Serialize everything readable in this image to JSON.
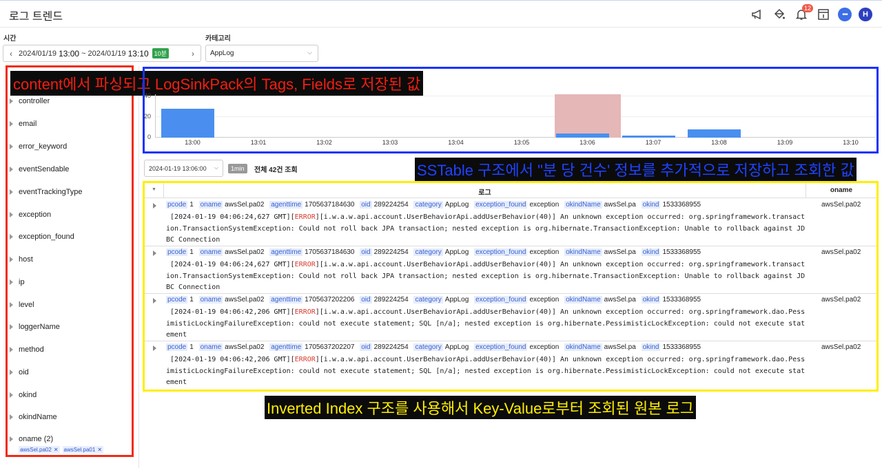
{
  "header": {
    "title": "로그 트렌드",
    "notif_count": "12",
    "avatar_letter": "H",
    "icons": [
      "megaphone-icon",
      "paint-bucket-icon",
      "bell-icon",
      "info-panel-icon",
      "chat-icon",
      "avatar"
    ]
  },
  "filters": {
    "time_label": "시간",
    "time_start_date": "2024/01/19",
    "time_start": "13:00",
    "time_sep": "~",
    "time_end_date": "2024/01/19",
    "time_end": "13:10",
    "time_span_badge": "10분",
    "category_label": "카테고리",
    "category_value": "AppLog"
  },
  "sidebar": {
    "fields": [
      "controller",
      "email",
      "error_keyword",
      "eventSendable",
      "eventTrackingType",
      "exception",
      "exception_found",
      "host",
      "ip",
      "level",
      "loggerName",
      "method",
      "oid",
      "okind",
      "okindName",
      "oname (2)"
    ],
    "selected_chips": [
      "awsSel.pa02",
      "awsSel.pa01"
    ]
  },
  "annotations": {
    "red": "content에서 파싱되고 LogSinkPack의 Tags, Fields로 저장된 값",
    "blue": "SSTable 구조에서 \"분 당 건수' 정보를 추가적으로 저장하고 조회한 값",
    "yellow": "Inverted Index 구조를 사용해서 Key-Value로부터 조회된 원본 로그"
  },
  "chart_data": {
    "type": "bar",
    "categories": [
      "13:00",
      "13:01",
      "13:02",
      "13:03",
      "13:04",
      "13:05",
      "13:06",
      "13:07",
      "13:08",
      "13:09",
      "13:10"
    ],
    "values": [
      28,
      0,
      0,
      0,
      0,
      0,
      4,
      2,
      8,
      0,
      0
    ],
    "highlight_category": "13:06",
    "yticks": [
      "40",
      "20",
      "0"
    ],
    "ylim": [
      0,
      40
    ],
    "grid": true,
    "colors": {
      "bar": "#4a8fef",
      "highlight": "#e5b7b7"
    }
  },
  "results": {
    "selected_time": "2024-01-19 13:06:00",
    "interval_badge": "1min",
    "total_text": "전체 42건 조회",
    "columns": {
      "log": "로그",
      "oname": "oname"
    },
    "rows": [
      {
        "pcode": "1",
        "oname": "awsSel.pa02",
        "agenttime": "1705637184630",
        "oid": "289224254",
        "category": "AppLog",
        "exception_found": "exception",
        "okindName": "awsSel.pa",
        "okind": "1533368955",
        "msg_prefix": " [2024-01-19 04:06:24,627 GMT][",
        "level": "ERROR",
        "msg_rest": "][i.w.a.w.api.account.UserBehaviorApi.addUserBehavior(40)] An unknown exception occurred: org.springframework.transaction.TransactionSystemException: Could not roll back JPA transaction; nested exception is org.hibernate.TransactionException: Unable to rollback against JDBC Connection",
        "oname_col": "awsSel.pa02"
      },
      {
        "pcode": "1",
        "oname": "awsSel.pa02",
        "agenttime": "1705637184630",
        "oid": "289224254",
        "category": "AppLog",
        "exception_found": "exception",
        "okindName": "awsSel.pa",
        "okind": "1533368955",
        "msg_prefix": " [2024-01-19 04:06:24,627 GMT][",
        "level": "ERROR",
        "msg_rest": "][i.w.a.w.api.account.UserBehaviorApi.addUserBehavior(40)] An unknown exception occurred: org.springframework.transaction.TransactionSystemException: Could not roll back JPA transaction; nested exception is org.hibernate.TransactionException: Unable to rollback against JDBC Connection",
        "oname_col": "awsSel.pa02"
      },
      {
        "pcode": "1",
        "oname": "awsSel.pa02",
        "agenttime": "1705637202206",
        "oid": "289224254",
        "category": "AppLog",
        "exception_found": "exception",
        "okindName": "awsSel.pa",
        "okind": "1533368955",
        "msg_prefix": " [2024-01-19 04:06:42,206 GMT][",
        "level": "ERROR",
        "msg_rest": "][i.w.a.w.api.account.UserBehaviorApi.addUserBehavior(40)] An unknown exception occurred: org.springframework.dao.PessimisticLockingFailureException: could not execute statement; SQL [n/a]; nested exception is org.hibernate.PessimisticLockException: could not execute statement",
        "oname_col": "awsSel.pa02"
      },
      {
        "pcode": "1",
        "oname": "awsSel.pa02",
        "agenttime": "1705637202207",
        "oid": "289224254",
        "category": "AppLog",
        "exception_found": "exception",
        "okindName": "awsSel.pa",
        "okind": "1533368955",
        "msg_prefix": " [2024-01-19 04:06:42,206 GMT][",
        "level": "ERROR",
        "msg_rest": "][i.w.a.w.api.account.UserBehaviorApi.addUserBehavior(40)] An unknown exception occurred: org.springframework.dao.PessimisticLockingFailureException: could not execute statement; SQL [n/a]; nested exception is org.hibernate.PessimisticLockException: could not execute statement",
        "oname_col": "awsSel.pa02"
      }
    ]
  }
}
